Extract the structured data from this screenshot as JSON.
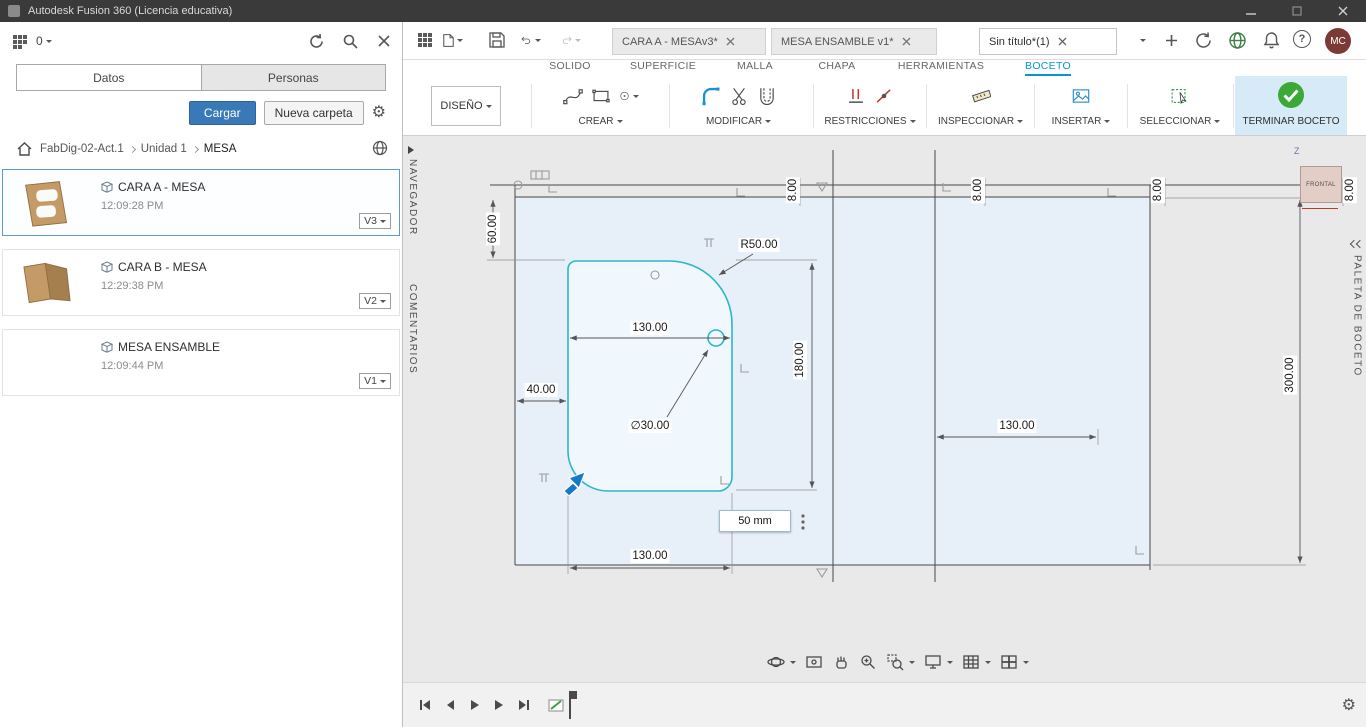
{
  "window": {
    "title": "Autodesk Fusion 360 (Licencia educativa)"
  },
  "icons": {
    "help": "?",
    "gear": "⚙"
  },
  "left_panel": {
    "count": "0",
    "tabs": {
      "datos": "Datos",
      "personas": "Personas"
    },
    "actions": {
      "cargar": "Cargar",
      "nueva_carpeta": "Nueva carpeta"
    },
    "breadcrumb": {
      "level1": "FabDig-02-Act.1",
      "level2": "Unidad 1",
      "level3": "MESA"
    },
    "items": [
      {
        "name": "CARA A - MESA",
        "time": "12:09:28 PM",
        "version": "V3"
      },
      {
        "name": "CARA B - MESA",
        "time": "12:29:38 PM",
        "version": "V2"
      },
      {
        "name": "MESA ENSAMBLE",
        "time": "12:09:44 PM",
        "version": "V1"
      }
    ]
  },
  "doc_tabs": {
    "tab1": "CARA A - MESAv3*",
    "tab2": "MESA ENSAMBLE v1*",
    "tab3": "Sin título*(1)"
  },
  "account": {
    "avatar": "MC"
  },
  "ribbon": {
    "solido": "SOLIDO",
    "superficie": "SUPERFICIE",
    "malla": "MALLA",
    "chapa": "CHAPA",
    "herramientas": "HERRAMIENTAS",
    "boceto": "BOCETO"
  },
  "toolbar": {
    "diseno": "DISEÑO",
    "crear": "CREAR",
    "modificar": "MODIFICAR",
    "restricciones": "RESTRICCIONES",
    "inspeccionar": "INSPECCIONAR",
    "insertar": "INSERTAR",
    "seleccionar": "SELECCIONAR",
    "terminar": "TERMINAR BOCETO"
  },
  "side_panels": {
    "navegador": "NAVEGADOR",
    "comentarios": "COMENTARIOS",
    "paleta": "PALETA DE BOCETO"
  },
  "viewcube": {
    "face": "FRONTAL",
    "axis_z": "Z"
  },
  "sketch": {
    "dims": {
      "d60": "60.00",
      "r50": "R50.00",
      "w130_top": "130.00",
      "h180": "180.00",
      "w40": "40.00",
      "dia30": "∅30.00",
      "w130_bottom": "130.00",
      "w130_right": "130.00",
      "h300": "300.00",
      "t8": "8.00"
    },
    "input": {
      "value": "50 mm"
    }
  }
}
